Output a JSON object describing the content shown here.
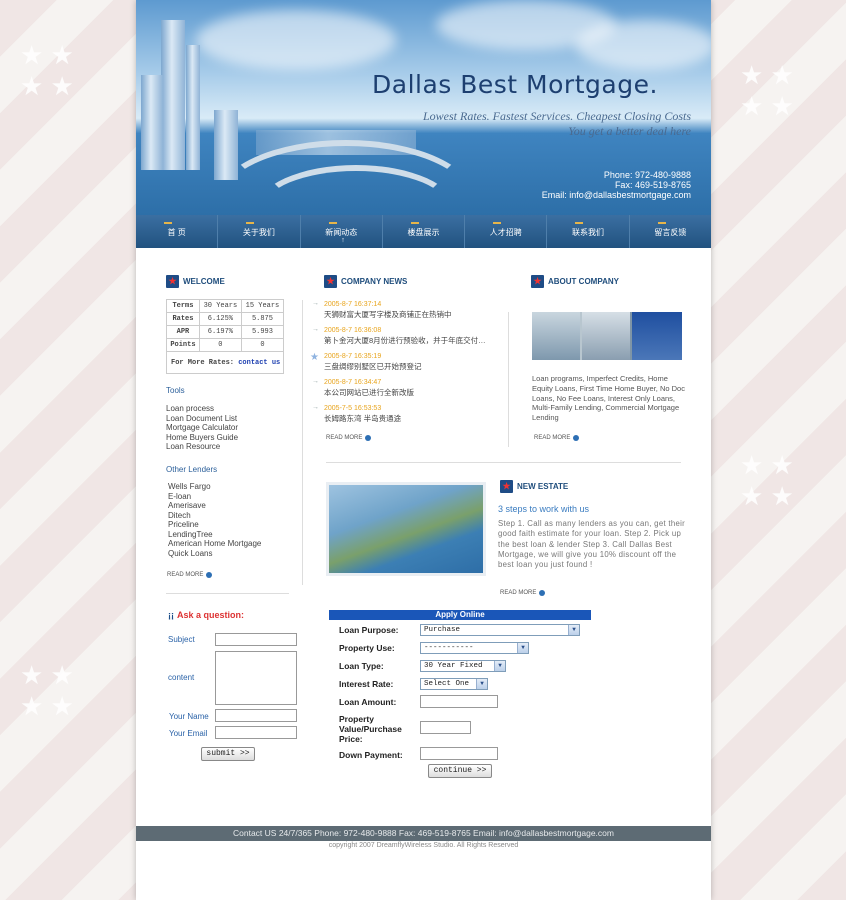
{
  "header": {
    "brand": "Dallas Best Mortgage.",
    "tagline1": "Lowest Rates.   Fastest Services.   Cheapest Closing Costs",
    "tagline2": "You get a better deal here",
    "phone": "Phone: 972-480-9888",
    "fax": "Fax: 469-519-8765",
    "email": "Email: info@dallasbestmortgage.com"
  },
  "nav": [
    "首 页",
    "关于我们",
    "新闻动态",
    "楼盘展示",
    "人才招聘",
    "联系我们",
    "留言反馈"
  ],
  "welcome": {
    "title": "WELCOME",
    "table": {
      "header": [
        "Terms",
        "30 Years",
        "15 Years"
      ],
      "rows": [
        [
          "Rates",
          "6.125%",
          "5.875"
        ],
        [
          "APR",
          "6.197%",
          "5.993"
        ],
        [
          "Points",
          "0",
          "0"
        ]
      ],
      "more_label": "For More Rates:",
      "more_link": "contact us"
    },
    "tools_title": "Tools",
    "tools": [
      "Loan process",
      "Loan Document List",
      "Mortgage Calculator",
      "Home Buyers Guide",
      "Loan Resource"
    ],
    "lenders_title": "Other Lenders",
    "lenders": [
      "Wells Fargo",
      "E-loan",
      "Amerisave",
      "Ditech",
      "Priceline",
      "LendingTree",
      "American Home Mortgage",
      "Quick Loans"
    ],
    "read_more": "READ MORE"
  },
  "news": {
    "title": "COMPANY NEWS",
    "items": [
      {
        "date": "2005-8-7 16:37:14",
        "text": "天狮财富大厦写字楼及商铺正在热销中"
      },
      {
        "date": "2005-8-7 16:36:08",
        "text": "第卜金河大厦8月份进行预验收，并于年底交付…"
      },
      {
        "date": "2005-8-7 16:35:19",
        "text": "三盘绸缪别墅区已开始预登记"
      },
      {
        "date": "2005-8-7 16:34:47",
        "text": "本公司网站已进行全新改版"
      },
      {
        "date": "2005-7-5 16:53:53",
        "text": "长姆路东湾 半岛贵通途"
      }
    ],
    "read_more": "READ MORE"
  },
  "about": {
    "title": "ABOUT COMPANY",
    "text": "Loan programs, Imperfect Credits, Home Equity Loans, First Time Home Buyer, No Doc Loans, No Fee Loans, Interest Only Loans, Multi-Family Lending, Commercial Mortgage Lending",
    "read_more": "READ MORE"
  },
  "estate": {
    "title": "NEW ESTATE",
    "heading": "3 steps to work with us",
    "text": "Step 1. Call as many lenders as you can, get their good faith estimate for your loan. Step 2. Pick up the best loan & lender Step 3. Call Dallas Best Mortgage, we will give you 10% discount off the best loan you just found !",
    "read_more": "READ MORE"
  },
  "ask": {
    "title": "Ask a question:",
    "subject": "Subject",
    "content": "content",
    "name": "Your Name",
    "email": "Your Email",
    "submit": "submit >>"
  },
  "apply": {
    "title": "Apply Online",
    "loan_purpose": {
      "label": "Loan Purpose:",
      "value": "Purchase"
    },
    "property_use": {
      "label": "Property Use:",
      "value": "-----------"
    },
    "loan_type": {
      "label": "Loan Type:",
      "value": "30 Year Fixed"
    },
    "interest_rate": {
      "label": "Interest Rate:",
      "value": "Select One"
    },
    "loan_amount": {
      "label": "Loan Amount:"
    },
    "property_value": {
      "label": "Property Value/Purchase Price:"
    },
    "down_payment": {
      "label": "Down Payment:"
    },
    "continue": "continue >>"
  },
  "footer": {
    "contact": "Contact US 24/7/365  Phone: 972-480-9888  Fax: 469-519-8765  Email: info@dallasbestmortgage.com",
    "copyright": "copyright 2007 DreamflyWireless Studio. All Rights Reserved"
  }
}
